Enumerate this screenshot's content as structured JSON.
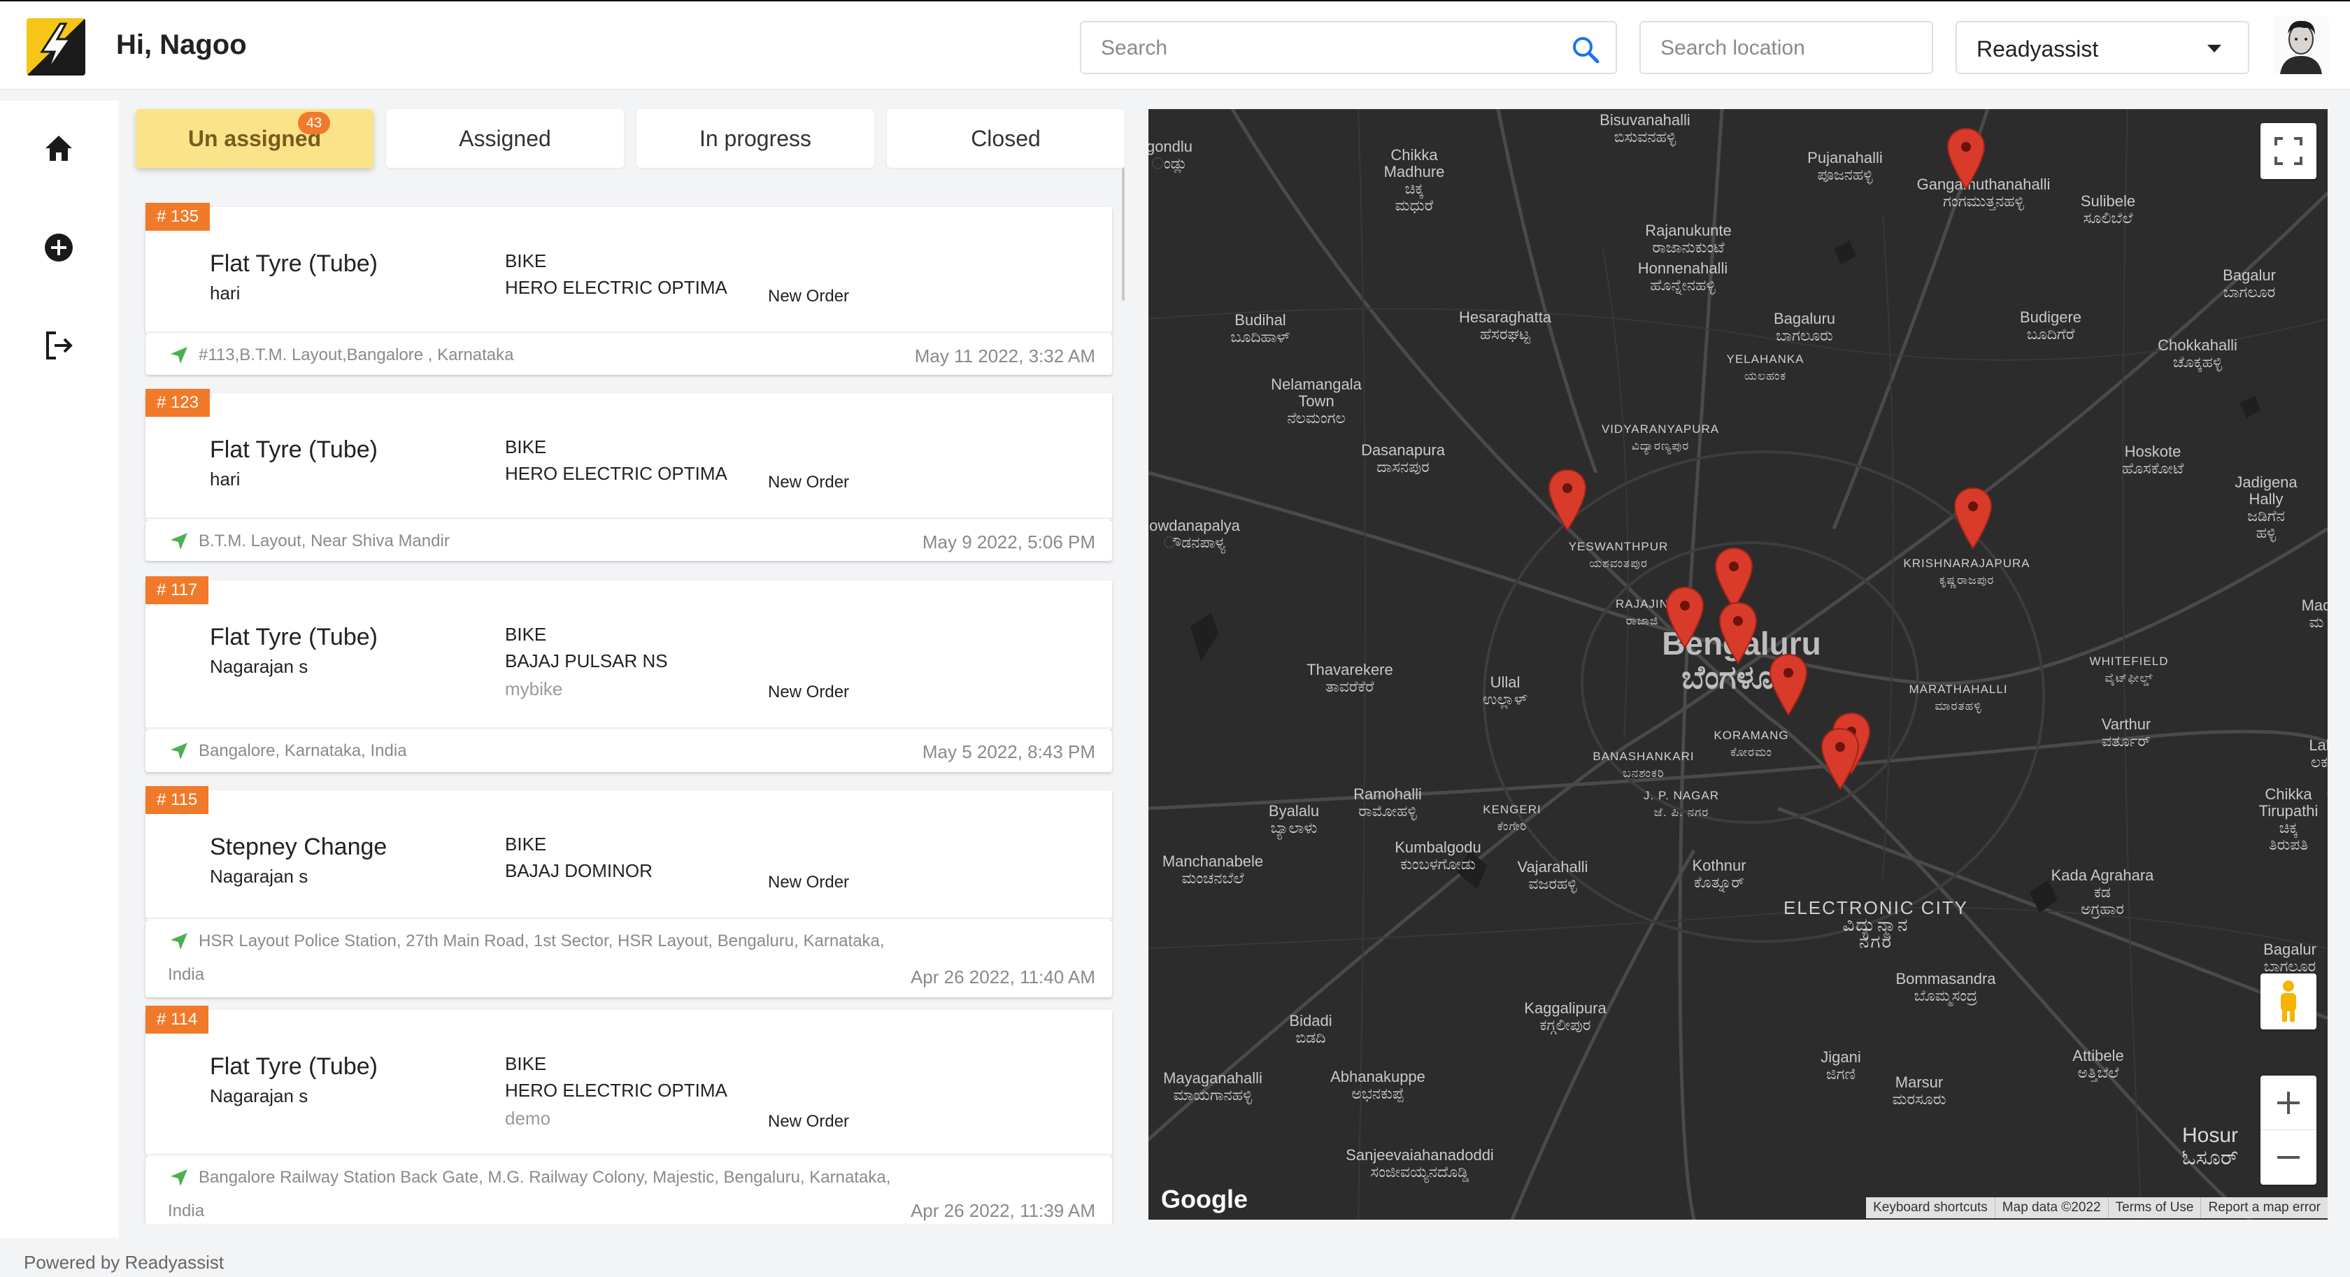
{
  "header": {
    "greeting": "Hi, Nagoo",
    "search_placeholder": "Search",
    "location_placeholder": "Search location",
    "org_selected": "Readyassist"
  },
  "rail": {
    "icons": [
      "home-icon",
      "add-circle-icon",
      "logout-icon"
    ]
  },
  "tabs": [
    {
      "label": "Un assigned",
      "badge": "43",
      "active": true
    },
    {
      "label": "Assigned"
    },
    {
      "label": "In progress"
    },
    {
      "label": "Closed"
    }
  ],
  "cards": [
    {
      "id": "# 135",
      "service": "Flat Tyre (Tube)",
      "customer": "hari",
      "vehicle_type": "BIKE",
      "vehicle_model": "HERO ELECTRIC OPTIMA",
      "vehicle_note": "",
      "status": "New Order",
      "address": "#113,B.T.M. Layout,Bangalore , Karnataka",
      "date": "May 11 2022, 3:32 AM"
    },
    {
      "id": "# 123",
      "service": "Flat Tyre (Tube)",
      "customer": "hari",
      "vehicle_type": "BIKE",
      "vehicle_model": "HERO ELECTRIC OPTIMA",
      "vehicle_note": "",
      "status": "New Order",
      "address": "B.T.M. Layout, Near Shiva Mandir",
      "date": "May 9 2022, 5:06 PM"
    },
    {
      "id": "# 117",
      "service": "Flat Tyre (Tube)",
      "customer": "Nagarajan s",
      "vehicle_type": "BIKE",
      "vehicle_model": "BAJAJ PULSAR NS",
      "vehicle_note": "mybike",
      "status": "New Order",
      "address": "Bangalore, Karnataka, India",
      "date": "May 5 2022, 8:43 PM"
    },
    {
      "id": "# 115",
      "service": "Stepney Change",
      "customer": "Nagarajan s",
      "vehicle_type": "BIKE",
      "vehicle_model": "BAJAJ DOMINOR",
      "vehicle_note": "",
      "status": "New Order",
      "address": "HSR Layout Police Station, 27th Main Road, 1st Sector, HSR Layout, Bengaluru, Karnataka, India",
      "date": "Apr 26 2022, 11:40 AM"
    },
    {
      "id": "# 114",
      "service": "Flat Tyre (Tube)",
      "customer": "Nagarajan s",
      "vehicle_type": "BIKE",
      "vehicle_model": "HERO ELECTRIC OPTIMA",
      "vehicle_note": "demo",
      "status": "New Order",
      "address": "Bangalore Railway Station Back Gate, M.G. Railway Colony, Majestic, Bengaluru, Karnataka, India",
      "date": "Apr 26 2022, 11:39 AM"
    }
  ],
  "map": {
    "labels": [
      "Bisuvanahalli\nಬಿಸುವನಹಳ್ಳಿ",
      "Chikka\nMadhure\nಚಿಕ್ಕ\nಮಧುರೆ",
      "Pujanahalli\nಪೂಜನಹಳ್ಳಿ",
      "Gangamuthanahalli\nಗಂಗಮುತ್ತನಹಳ್ಳಿ",
      "Sulibele\nಸೂಲಿಬೆಲೆ",
      "Rajanukunte\nರಾಜಾನುಕುಂಟೆ",
      "Honnenahalli\nಹೊನ್ನೇನಹಳ್ಳಿ",
      "Bagalur\nಬಾಗಲೂರ",
      "Budihal\nಬೂದಿಹಾಳ್",
      "Hesaraghatta\nಹೆಸರಘಟ್ಟ",
      "Bagaluru\nಬಾಗಲೂರು",
      "Budigere\nಬೂದಿಗೆರೆ",
      "Chokkahalli\nಚೊಕ್ಕಹಳ್ಳಿ",
      "YELAHANKA\nಯಲಹಂಕ",
      "Nelamangala\nTown\nನೆಲಮಂಗಲ",
      "VIDYARANYAPURA\nವಿದ್ಯಾರಣ್ಯಪುರ",
      "Dasanapura\nದಾಸನಪುರ",
      "Hoskote\nಹೊಸಕೋಟೆ",
      "Jadigena Hally\nಜಡಿಗೆನ\nಹಳ್ಳಿ",
      "owdanapalya\nೌಡನಪಾಳ್ಯ",
      "YESWANTHPUR\nಯಶವಂತಪುರ",
      "KRISHNARAJAPURA\nಕೃಷ್ಣರಾಜಪುರ",
      "RAJAJIN\nರಾಜಾಜಿ",
      "Bengaluru\nಬೆಂಗಳೂರು",
      "Thavarekere\nತಾವರೆಕೆರೆ",
      "Ullal\nಉಲ್ಲಾಳ್",
      "WHITEFIELD\nವೈಟ್‌ಫೀಲ್ಡ್",
      "MARATHAHALLI\nಮಾರತಹಳ್ಳಿ",
      "KORAMANG\nಕೋರಮಂ",
      "BANASHANKARI\nಬನಶಂಕರಿ",
      "Varthur\nವರ್ತೂರ್",
      "Ramohalli\nರಾಮೋಹಳ್ಳಿ",
      "J. P. NAGAR\nಜೆ. ಪಿ. ನಗರ",
      "KENGERI\nಕೆಂಗೇರಿ",
      "Byalalu\nಬ್ಯಾಲಾಳು",
      "Kumbalgodu\nಕುಂಬಳಗೋಡು",
      "Chikka\nTirupathi\nಚಿಕ್ಕ\nತಿರುಪತಿ",
      "Manchanabele\nಮಂಚನಬೆಲೆ",
      "Vajarahalli\nವಜರಹಳ್ಳಿ",
      "Kothnur\nಕೊತ್ನೂರ್",
      "Kada Agrahara\nಕಡ\nಅಗ್ರಹಾರ",
      "ELECTRONIC CITY\nವಿದ್ಯುನ್ಮಾನ\nನಗರ",
      "Bagalur\nಬಾಗಲೂರ",
      "Bommasandra\nಬೊಮ್ಮಸಂದ್ರ",
      "Kaggalipura\nಕಗ್ಗಲೀಪುರ",
      "Bidadi\nಬಿಡದಿ",
      "Attibele\nಅತ್ತಿಬೆಲೆ",
      "Mayaganahalli\nಮಾಯಗಾನಹಳ್ಳಿ",
      "Abhanakuppe\nಅಭನಕುಪ್ಪೆ",
      "Jigani\nಜಿಗಣಿ",
      "Marsur\nಮರಸೂರು",
      "Hosur\nಓಸೂರ್",
      "Sanjeevaiahanadoddi\nಸಂಜೀವಯ್ಯನದೊಡ್ಡಿ",
      "Mad\nಮ",
      "Lal\nಲಕ",
      "gondlu\nಂಡ್ಲು"
    ],
    "attribution": [
      "Keyboard shortcuts",
      "Map data ©2022",
      "Terms of Use",
      "Report a map error"
    ],
    "brand": "Google"
  },
  "footer": "Powered by Readyassist"
}
